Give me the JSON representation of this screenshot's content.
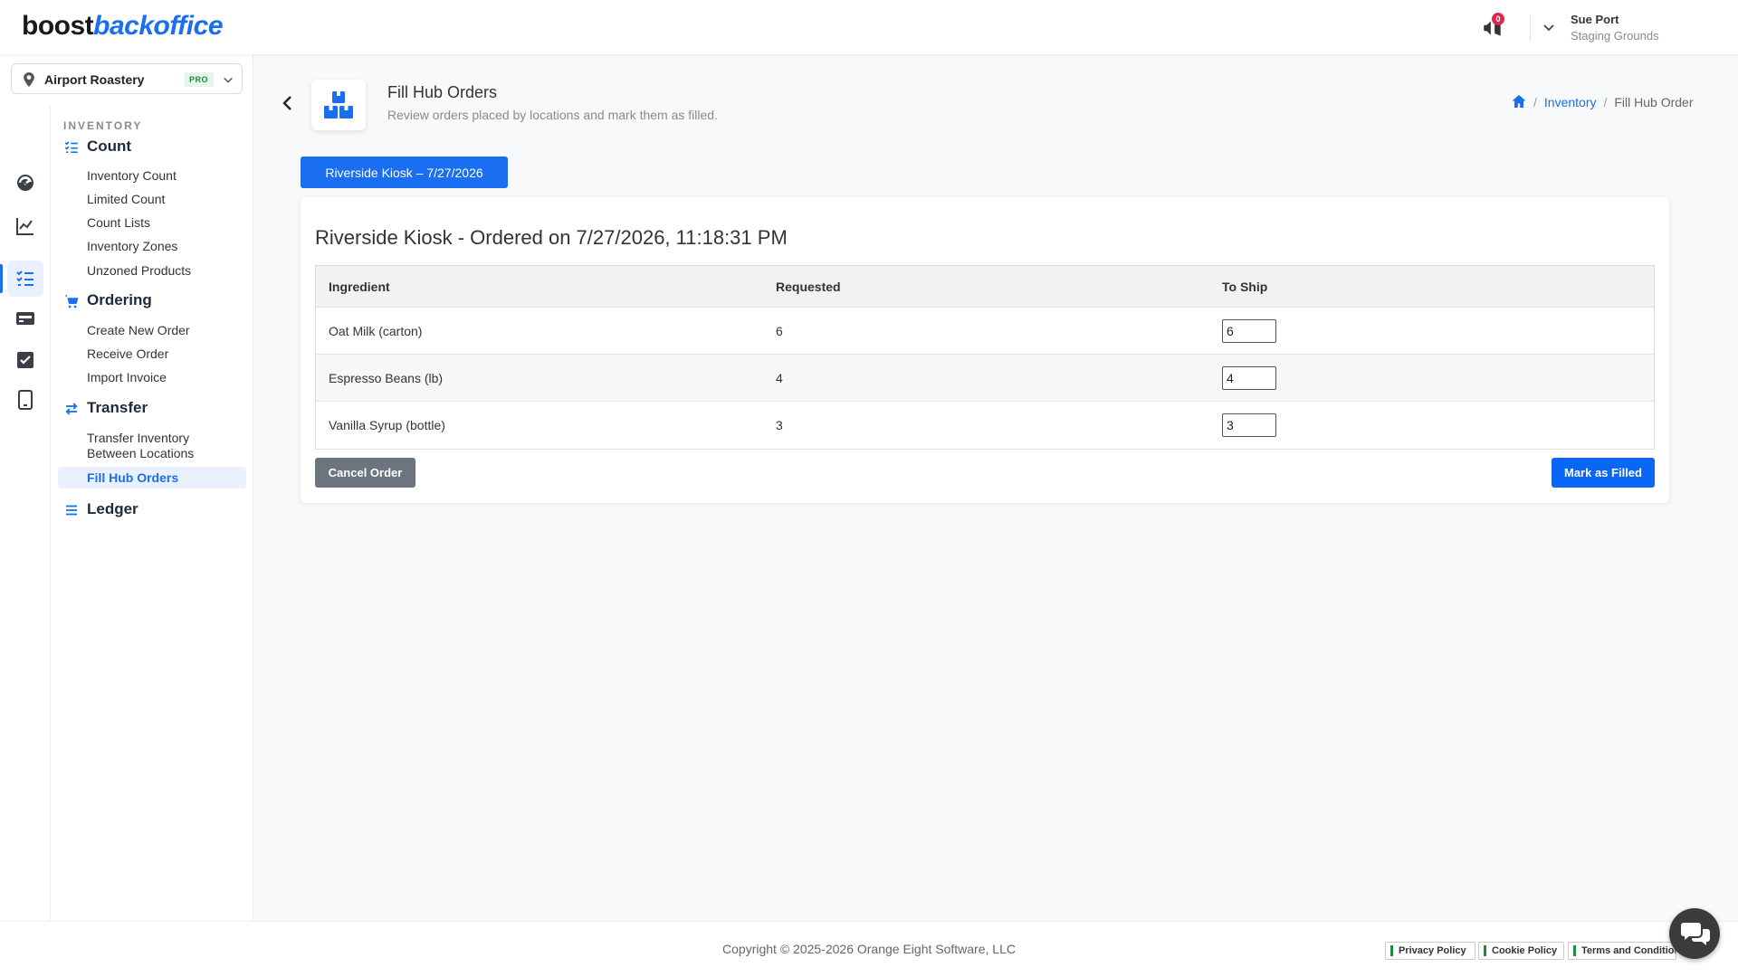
{
  "header": {
    "logo_part1": "boost",
    "logo_part2": "backoffice",
    "notification_count": "0",
    "user_name": "Sue Port",
    "user_location": "Staging Grounds"
  },
  "location_select": {
    "value": "Airport Roastery",
    "badge": "PRO"
  },
  "nav": {
    "section_title": "INVENTORY",
    "groups": [
      {
        "label": "Count",
        "items": [
          "Inventory Count",
          "Limited Count",
          "Count Lists",
          "Inventory Zones",
          "Unzoned Products"
        ]
      },
      {
        "label": "Ordering",
        "items": [
          "Create New Order",
          "Receive Order",
          "Import Invoice"
        ]
      },
      {
        "label": "Transfer",
        "items": [
          "Transfer Inventory",
          "Between Locations",
          "Fill Hub Orders"
        ]
      },
      {
        "label": "Ledger",
        "items": []
      }
    ]
  },
  "page": {
    "title": "Fill Hub Orders",
    "subtitle": "Review orders placed by locations and mark them as filled.",
    "breadcrumb": [
      "Inventory",
      "Fill Hub Order"
    ]
  },
  "order_tab": "Riverside Kiosk – 7/27/2026",
  "order": {
    "title": "Riverside Kiosk - Ordered on 7/27/2026, 11:18:31 PM",
    "columns": [
      "Ingredient",
      "Requested",
      "To Ship"
    ],
    "rows": [
      {
        "ingredient": "Oat Milk (carton)",
        "requested": "6",
        "to_ship": "6"
      },
      {
        "ingredient": "Espresso Beans (lb)",
        "requested": "4",
        "to_ship": "4"
      },
      {
        "ingredient": "Vanilla Syrup (bottle)",
        "requested": "3",
        "to_ship": "3"
      }
    ],
    "cancel_label": "Cancel Order",
    "fill_label": "Mark as Filled"
  },
  "footer": {
    "copyright": "Copyright © 2025-2026 Orange Eight Software, LLC",
    "links": [
      "Privacy Policy",
      "Cookie Policy",
      "Terms and Conditions"
    ]
  },
  "colors": {
    "accent": "#1a6ef2",
    "badge_red": "#e0284a",
    "cancel_gray": "#6c757d"
  }
}
